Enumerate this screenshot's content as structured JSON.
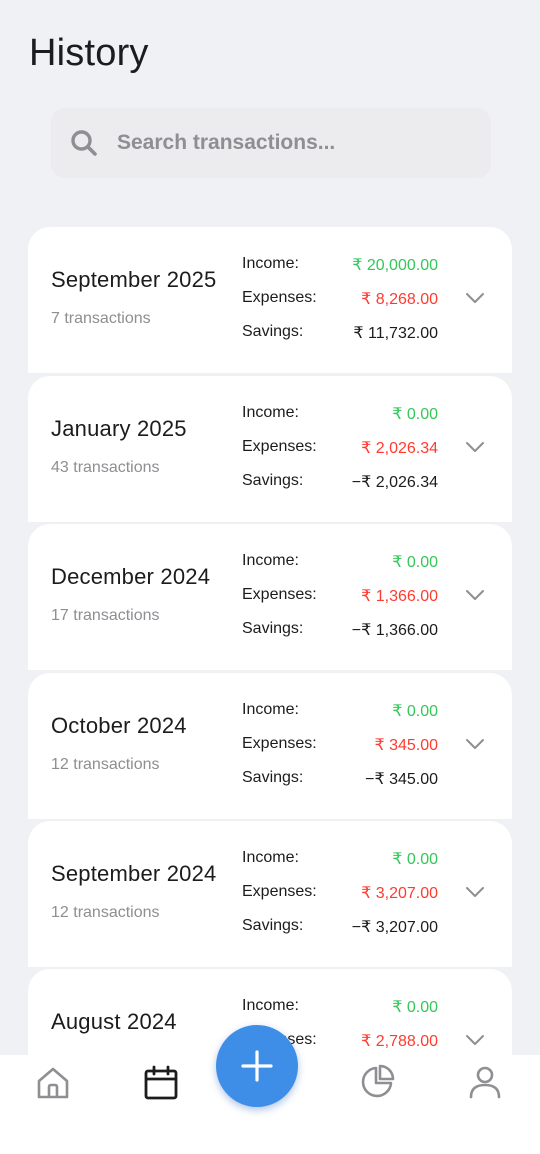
{
  "header": {
    "title": "History"
  },
  "search": {
    "placeholder": "Search transactions..."
  },
  "labels": {
    "income": "Income:",
    "expenses": "Expenses:",
    "savings": "Savings:"
  },
  "months": [
    {
      "month": "September 2025",
      "count": "7 transactions",
      "income": "₹ 20,000.00",
      "expenses": "₹ 8,268.00",
      "savings": "₹ 11,732.00"
    },
    {
      "month": "January 2025",
      "count": "43 transactions",
      "income": "₹ 0.00",
      "expenses": "₹ 2,026.34",
      "savings": "−₹ 2,026.34"
    },
    {
      "month": "December 2024",
      "count": "17 transactions",
      "income": "₹ 0.00",
      "expenses": "₹ 1,366.00",
      "savings": "−₹ 1,366.00"
    },
    {
      "month": "October 2024",
      "count": "12 transactions",
      "income": "₹ 0.00",
      "expenses": "₹ 345.00",
      "savings": "−₹ 345.00"
    },
    {
      "month": "September 2024",
      "count": "12 transactions",
      "income": "₹ 0.00",
      "expenses": "₹ 3,207.00",
      "savings": "−₹ 3,207.00"
    },
    {
      "month": "August 2024",
      "count": "",
      "income": "₹ 0.00",
      "expenses": "₹ 2,788.00",
      "savings": ""
    }
  ],
  "colors": {
    "income": "#34c759",
    "expenses": "#ff3b30",
    "accent": "#3e8ee8",
    "background": "#f0f1f5"
  },
  "tabbar": {
    "items": [
      {
        "name": "home",
        "icon": "home-icon"
      },
      {
        "name": "history",
        "icon": "calendar-icon",
        "active": true
      },
      {
        "name": "add",
        "icon": "plus-icon"
      },
      {
        "name": "stats",
        "icon": "pie-chart-icon"
      },
      {
        "name": "profile",
        "icon": "user-icon"
      }
    ]
  }
}
